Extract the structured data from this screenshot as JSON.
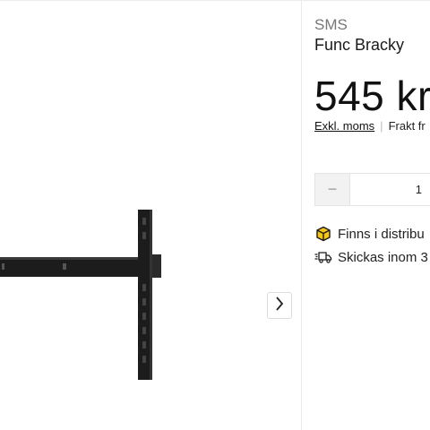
{
  "product": {
    "brand": "SMS",
    "name": "Func Bracky",
    "price": "545 kr",
    "vat_label": "Exkl. moms",
    "separator": "|",
    "shipping_label": "Frakt fr"
  },
  "quantity": {
    "decrement_symbol": "−",
    "value": "1"
  },
  "availability": [
    {
      "icon": "box-icon",
      "text": "Finns i distribu"
    },
    {
      "icon": "delivery-truck-icon",
      "text": "Skickas inom 3"
    }
  ],
  "gallery": {
    "image": "wall-mount-bracket",
    "next_icon": "chevron-right-icon"
  },
  "colors": {
    "accent_box": "#f5c518",
    "bracket": "#1c1c1c",
    "muted": "#777777"
  }
}
